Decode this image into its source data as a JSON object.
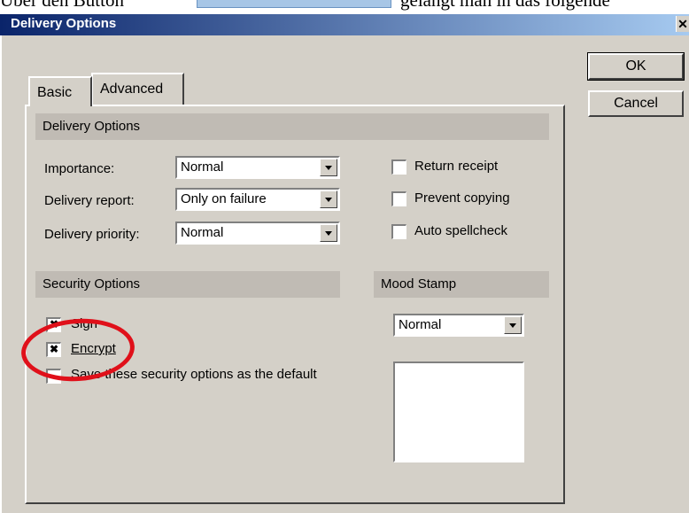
{
  "caption": {
    "prefix": "Über den Button",
    "suffix": "gelangt man in das folgende"
  },
  "window": {
    "title": "Delivery Options",
    "close_glyph": "✕"
  },
  "tabs": [
    {
      "label": "Basic",
      "active": true
    },
    {
      "label": "Advanced",
      "active": false
    }
  ],
  "buttons": {
    "ok": "OK",
    "cancel": "Cancel"
  },
  "delivery": {
    "header": "Delivery Options",
    "importance": {
      "label": "Importance:",
      "value": "Normal"
    },
    "report": {
      "label": "Delivery report:",
      "value": "Only on failure"
    },
    "priority": {
      "label": "Delivery priority:",
      "value": "Normal"
    }
  },
  "checks": {
    "return_receipt": {
      "label": "Return receipt",
      "checked": false
    },
    "prevent_copying": {
      "label": "Prevent copying",
      "checked": false
    },
    "auto_spellcheck": {
      "label": "Auto spellcheck",
      "checked": false
    }
  },
  "security": {
    "header": "Security Options",
    "sign": {
      "label": "Sign",
      "checked": true
    },
    "encrypt": {
      "label": "Encrypt",
      "checked": true
    },
    "default": {
      "label": "Save these security options as the default",
      "checked": false
    }
  },
  "mood": {
    "header": "Mood Stamp",
    "value": "Normal"
  },
  "glyphs": {
    "checked": "✖"
  },
  "colors": {
    "annotation": "#e0101a",
    "titlebar_start": "#0a246a",
    "titlebar_end": "#a6caf0",
    "face": "#d4d0c8"
  }
}
